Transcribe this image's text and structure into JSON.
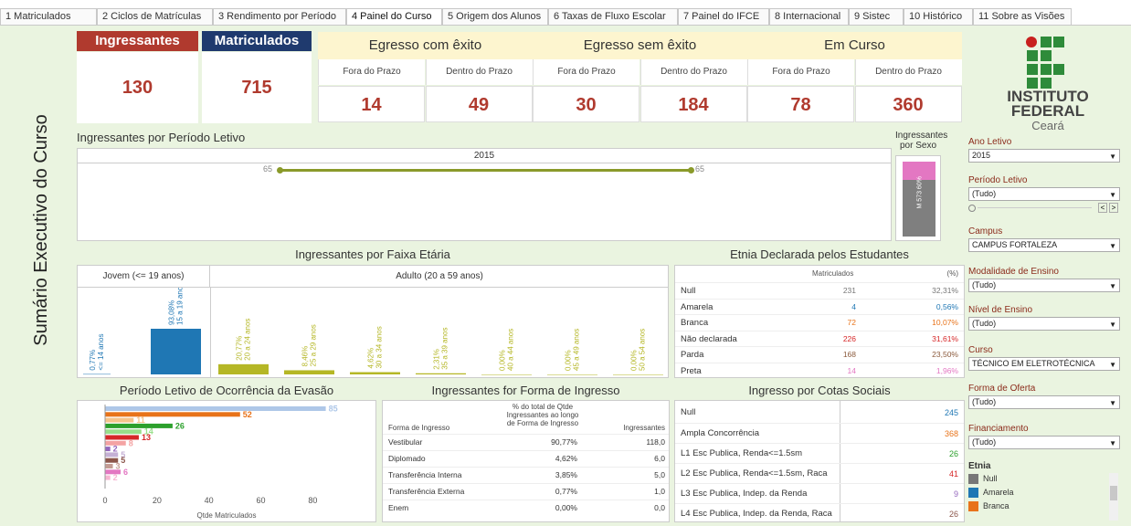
{
  "tabs": [
    "1 Matriculados",
    "2 Ciclos de Matrículas",
    "3 Rendimento por Período",
    "4 Painel do Curso",
    "5 Origem dos Alunos",
    "6 Taxas de Fluxo Escolar",
    "7 Painel do IFCE",
    "8 Internacional",
    "9 Sistec",
    "10 Histórico",
    "11 Sobre as Visões"
  ],
  "side_title": "Sumário Executivo do Curso",
  "kpi": {
    "ingressantes_label": "Ingressantes",
    "ingressantes_value": "130",
    "matriculados_label": "Matriculados",
    "matriculados_value": "715",
    "groups": [
      "Egresso com êxito",
      "Egresso sem êxito",
      "Em Curso"
    ],
    "subs": [
      "Fora do Prazo",
      "Dentro do Prazo",
      "Fora do Prazo",
      "Dentro do Prazo",
      "Fora do Prazo",
      "Dentro do Prazo"
    ],
    "values": [
      "14",
      "49",
      "30",
      "184",
      "78",
      "360"
    ]
  },
  "logo": {
    "line1": "INSTITUTO",
    "line2": "FEDERAL",
    "line3": "Ceará"
  },
  "periodo": {
    "title": "Ingressantes por Período Letivo",
    "year": "2015",
    "left_value": "65",
    "right_value": "65"
  },
  "sexo": {
    "title1": "Ingressantes",
    "title2": "por Sexo",
    "label1": "M",
    "label2": "573",
    "label3": "60%"
  },
  "faixa": {
    "title": "Ingressantes por Faixa Etária",
    "jovem": "Jovem (<= 19 anos)",
    "adulto": "Adulto (20 a 59 anos)",
    "bars": [
      {
        "pct": "0,77%",
        "lab": "<= 14 anos",
        "v": 0.77
      },
      {
        "pct": "93,08%",
        "lab": "15 a 19 anos",
        "v": 93.08
      },
      {
        "pct": "20,77%",
        "lab": "20 a 24 anos",
        "v": 20.77
      },
      {
        "pct": "8,46%",
        "lab": "25 a 29 anos",
        "v": 8.46
      },
      {
        "pct": "4,62%",
        "lab": "30 a 34 anos",
        "v": 4.62
      },
      {
        "pct": "2,31%",
        "lab": "35 a 39 anos",
        "v": 2.31
      },
      {
        "pct": "0,00%",
        "lab": "40 a 44 anos",
        "v": 0
      },
      {
        "pct": "0,00%",
        "lab": "45 a 49 anos",
        "v": 0
      },
      {
        "pct": "0,00%",
        "lab": "50 a 54 anos",
        "v": 0
      }
    ]
  },
  "etnia_table": {
    "title": "Etnia Declarada pelos Estudantes",
    "col1": "Matriculados",
    "col2": "(%)",
    "rows": [
      {
        "n": "Null",
        "v": "231",
        "p": "32,31%",
        "c": "#777"
      },
      {
        "n": "Amarela",
        "v": "4",
        "p": "0,56%",
        "c": "#1f77b4"
      },
      {
        "n": "Branca",
        "v": "72",
        "p": "10,07%",
        "c": "#e8731a"
      },
      {
        "n": "Não declarada",
        "v": "226",
        "p": "31,61%",
        "c": "#d62728"
      },
      {
        "n": "Parda",
        "v": "168",
        "p": "23,50%",
        "c": "#8b5a3c"
      },
      {
        "n": "Preta",
        "v": "14",
        "p": "1,96%",
        "c": "#e377c2"
      }
    ]
  },
  "evasao": {
    "title": "Período Letivo de Ocorrência da Evasão",
    "xlabel": "Qtde Matriculados",
    "ticks": [
      "0",
      "20",
      "40",
      "60",
      "80"
    ],
    "bars": [
      {
        "v": 85,
        "c": "#aec7e8",
        "lab": "85"
      },
      {
        "v": 52,
        "c": "#e8731a",
        "lab": "52"
      },
      {
        "v": 11,
        "c": "#f5c48c",
        "lab": "11"
      },
      {
        "v": 26,
        "c": "#2ca02c",
        "lab": "26"
      },
      {
        "v": 14,
        "c": "#98df8a",
        "lab": "14"
      },
      {
        "v": 13,
        "c": "#d62728",
        "lab": "13"
      },
      {
        "v": 8,
        "c": "#f4a3a3",
        "lab": "8"
      },
      {
        "v": 2,
        "c": "#9467bd",
        "lab": "2"
      },
      {
        "v": 5,
        "c": "#c5b0d5",
        "lab": "5"
      },
      {
        "v": 5,
        "c": "#8c564b",
        "lab": "5"
      },
      {
        "v": 3,
        "c": "#c49c94",
        "lab": "3"
      },
      {
        "v": 6,
        "c": "#e377c2",
        "lab": "6"
      },
      {
        "v": 2,
        "c": "#f7b6d2",
        "lab": "2"
      }
    ]
  },
  "forma": {
    "title": "Ingressantes for Forma de Ingresso",
    "h1": "Forma de Ingresso",
    "h2a": "% do total de Qtde",
    "h2b": "Ingressantes ao longo",
    "h2c": "de Forma de Ingresso",
    "h3": "Ingressantes",
    "rows": [
      {
        "n": "Vestibular",
        "p": "90,77%",
        "v": "118,0"
      },
      {
        "n": "Diplomado",
        "p": "4,62%",
        "v": "6,0"
      },
      {
        "n": "Transferência Interna",
        "p": "3,85%",
        "v": "5,0"
      },
      {
        "n": "Transferência Externa",
        "p": "0,77%",
        "v": "1,0"
      },
      {
        "n": "Enem",
        "p": "0,00%",
        "v": "0,0"
      }
    ]
  },
  "cotas": {
    "title": "Ingresso por Cotas Sociais",
    "rows": [
      {
        "n": "Null",
        "v": "245",
        "c": "#1f77b4"
      },
      {
        "n": "Ampla Concorrência",
        "v": "368",
        "c": "#e8731a"
      },
      {
        "n": "L1 Esc Publica, Renda<=1.5sm",
        "v": "26",
        "c": "#2ca02c"
      },
      {
        "n": "L2 Esc Publica, Renda<=1.5sm, Raca",
        "v": "41",
        "c": "#d62728"
      },
      {
        "n": "L3 Esc Publica, Indep. da Renda",
        "v": "9",
        "c": "#9467bd"
      },
      {
        "n": "L4 Esc Publica, Indep. da Renda, Raca",
        "v": "26",
        "c": "#8c564b"
      }
    ]
  },
  "filters": [
    {
      "label": "Ano Letivo",
      "value": "2015"
    },
    {
      "label": "Período Letivo",
      "value": "(Tudo)"
    },
    {
      "label": "Campus",
      "value": "CAMPUS FORTALEZA"
    },
    {
      "label": "Modalidade de Ensino",
      "value": "(Tudo)"
    },
    {
      "label": "Nível de Ensino",
      "value": "(Tudo)"
    },
    {
      "label": "Curso",
      "value": "TÉCNICO EM ELETROTÉCNICA"
    },
    {
      "label": "Forma de Oferta",
      "value": "(Tudo)"
    },
    {
      "label": "Financiamento",
      "value": "(Tudo)"
    }
  ],
  "etnia_legend": {
    "label": "Etnia",
    "items": [
      {
        "n": "Null",
        "c": "#777777"
      },
      {
        "n": "Amarela",
        "c": "#1f77b4"
      },
      {
        "n": "Branca",
        "c": "#e8731a"
      }
    ]
  },
  "colors": {
    "kpi_red": "#b03a2e",
    "kpi_navy": "#1f3a6e",
    "bg": "#eaf4e0",
    "logo_green": "#2e8b3a",
    "logo_red": "#c8201e",
    "olive": "#b5b726",
    "blue": "#1f77b4"
  }
}
